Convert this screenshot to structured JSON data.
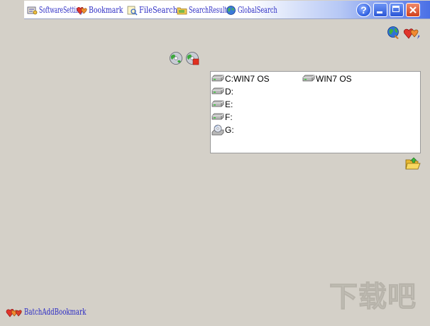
{
  "tabs": [
    {
      "id": "software",
      "label": "SoftwareSetting",
      "icon": "settings-icon"
    },
    {
      "id": "bookmark",
      "label": "Bookmark",
      "icon": "hearts-icon"
    },
    {
      "id": "filesearch",
      "label": "FileSearch",
      "icon": "file-search-icon"
    },
    {
      "id": "searchresult",
      "label": "SearchResult",
      "icon": "folder-icon"
    },
    {
      "id": "globalsearch",
      "label": "GlobalSearch",
      "icon": "globe-icon"
    }
  ],
  "window_buttons": {
    "help": "?"
  },
  "drives": [
    {
      "label": "C:WIN7 OS",
      "icon": "hard-drive-icon",
      "extra": "WIN7 OS"
    },
    {
      "label": "D:",
      "icon": "hard-drive-icon"
    },
    {
      "label": "E:",
      "icon": "hard-drive-icon"
    },
    {
      "label": "F:",
      "icon": "hard-drive-icon"
    },
    {
      "label": "G:",
      "icon": "optical-drive-icon"
    }
  ],
  "bottom_link": {
    "label": "BatchAddBookmark",
    "icon": "hearts-icon"
  },
  "watermark": {
    "text": "下载吧"
  },
  "colors": {
    "background": "#d4d0c8",
    "tab_text": "#2b2bc4",
    "titlebar_accent": "#4a6fe6",
    "close_button": "#d1401c"
  }
}
